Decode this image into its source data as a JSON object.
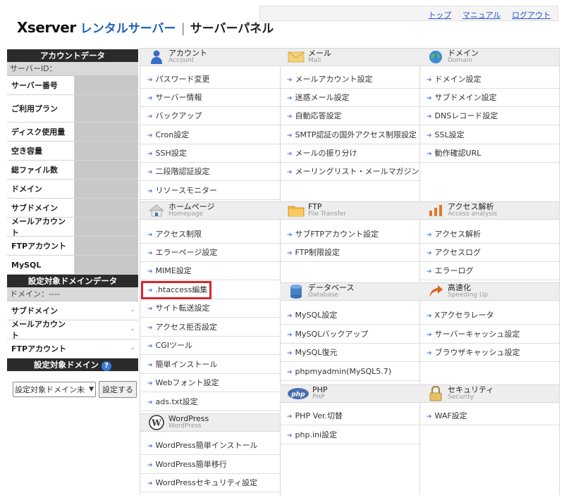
{
  "header": {
    "logo_brand": "Xserver",
    "logo_rental": "レンタルサーバー",
    "logo_sep": "|",
    "logo_panel": "サーバーパネル",
    "links": [
      "トップ",
      "マニュアル",
      "ログアウト"
    ]
  },
  "account_data": {
    "title": "アカウントデータ",
    "server_id_label": "サーバーID：",
    "rows": [
      "サーバー番号",
      "ご利用プラン",
      "ディスク使用量",
      "空き容量",
      "総ファイル数",
      "ドメイン",
      "サブドメイン",
      "メールアカウント",
      "FTPアカウント",
      "MySQL"
    ]
  },
  "domain_data": {
    "title": "設定対象ドメインデータ",
    "domain_label": "ドメイン：----",
    "rows": [
      {
        "label": "サブドメイン",
        "value": "-"
      },
      {
        "label": "メールアカウント",
        "value": "-"
      },
      {
        "label": "FTPアカウント",
        "value": "-"
      }
    ]
  },
  "domain_select": {
    "title": "設定対象ドメイン",
    "help": "?",
    "select_value": "設定対象ドメイン未",
    "button": "設定する"
  },
  "sections": {
    "account": {
      "title": "アカウント",
      "sub": "Account",
      "items": [
        "パスワード変更",
        "サーバー情報",
        "バックアップ",
        "Cron設定",
        "SSH設定",
        "二段階認証設定",
        "リソースモニター"
      ]
    },
    "homepage": {
      "title": "ホームページ",
      "sub": "Homepage",
      "items": [
        "アクセス制限",
        "エラーページ設定",
        "MIME設定",
        ".htaccess編集",
        "サイト転送設定",
        "アクセス拒否設定",
        "CGIツール",
        "簡単インストール",
        "Webフォント設定",
        "ads.txt設定"
      ]
    },
    "wordpress": {
      "title": "WordPress",
      "sub": "WordPress",
      "items": [
        "WordPress簡単インストール",
        "WordPress簡単移行",
        "WordPressセキュリティ設定"
      ]
    },
    "mail": {
      "title": "メール",
      "sub": "Mail",
      "items": [
        "メールアカウント設定",
        "迷惑メール設定",
        "自動応答設定",
        "SMTP認証の国外アクセス制限設定",
        "メールの振り分け",
        "メーリングリスト・メールマガジン"
      ]
    },
    "ftp": {
      "title": "FTP",
      "sub": "File Transfer",
      "items": [
        "サブFTPアカウント設定",
        "FTP制限設定"
      ]
    },
    "database": {
      "title": "データベース",
      "sub": "Database",
      "items": [
        "MySQL設定",
        "MySQLバックアップ",
        "MySQL復元",
        "phpmyadmin(MySQL5.7)"
      ]
    },
    "php": {
      "title": "PHP",
      "sub": "PHP",
      "items": [
        "PHP Ver.切替",
        "php.ini設定"
      ]
    },
    "domain": {
      "title": "ドメイン",
      "sub": "Domain",
      "items": [
        "ドメイン設定",
        "サブドメイン設定",
        "DNSレコード設定",
        "SSL設定",
        "動作確認URL"
      ]
    },
    "analytics": {
      "title": "アクセス解析",
      "sub": "Access analysis",
      "items": [
        "アクセス解析",
        "アクセスログ",
        "エラーログ"
      ]
    },
    "speed": {
      "title": "高速化",
      "sub": "Speeding Up",
      "items": [
        "Xアクセラレータ",
        "サーバーキャッシュ設定",
        "ブラウザキャッシュ設定"
      ]
    },
    "security": {
      "title": "セキュリティ",
      "sub": "Security",
      "items": [
        "WAF設定"
      ]
    }
  },
  "colors": {
    "accent": "#1f5fb8",
    "highlight": "#d4262e",
    "header_dark": "#2b2b2b"
  }
}
